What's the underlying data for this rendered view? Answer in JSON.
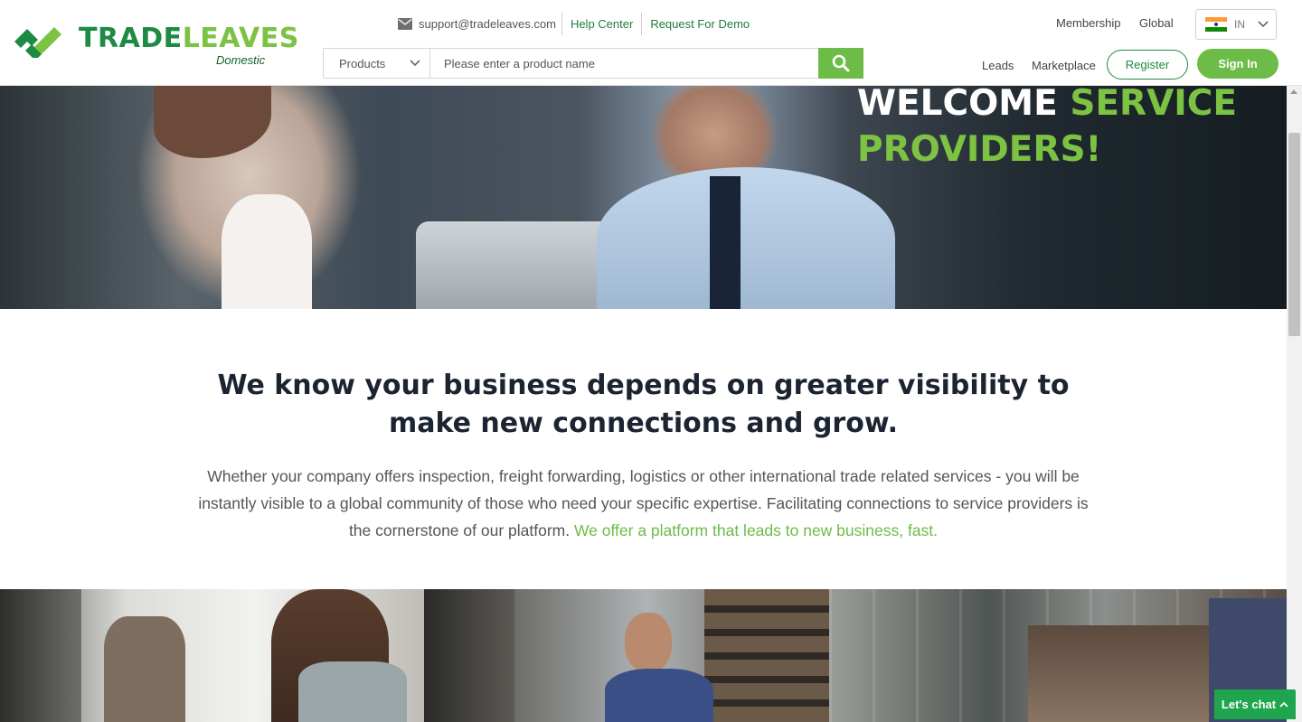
{
  "brand": {
    "name_part1": "TRADE",
    "name_part2": "LEAVES",
    "subtitle": "Domestic",
    "colors": {
      "dark_green": "#1f8a44",
      "light_green": "#7cc243",
      "accent": "#6cbc47"
    }
  },
  "contact": {
    "email_icon": "mail-icon",
    "email": "support@tradeleaves.com",
    "help_center": "Help Center",
    "request_demo": "Request For Demo"
  },
  "search": {
    "category": "Products",
    "placeholder": "Please enter a product name",
    "button_icon": "search-icon"
  },
  "nav": {
    "membership": "Membership",
    "global": "Global",
    "language": "IN",
    "leads": "Leads",
    "marketplace": "Marketplace",
    "register": "Register",
    "sign_in": "Sign In"
  },
  "hero": {
    "title_white": "WELCOME ",
    "title_green_1": "SERVICE",
    "title_green_2": "PROVIDERS!"
  },
  "intro": {
    "heading": "We know your business depends on greater visibility to make new connections and grow.",
    "body": "Whether your company offers inspection, freight forwarding, logistics or other international trade related services - you will be instantly visible to a global community of those who need your specific expertise. Facilitating connections to service providers is the cornerstone of our platform. ",
    "highlight": "We offer a platform that leads to new business, fast."
  },
  "chat": {
    "label": "Let's chat",
    "icon": "chevron-up-icon"
  }
}
